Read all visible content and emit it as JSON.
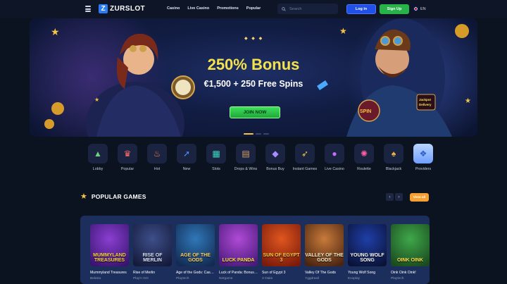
{
  "header": {
    "logo_letter": "Z",
    "logo_text": "ZURSLOT",
    "nav": [
      "Casino",
      "Live Casino",
      "Promotions",
      "Popular"
    ],
    "search_placeholder": "Search",
    "login_label": "Log in",
    "signup_label": "Sign Up",
    "language": "EN"
  },
  "hero": {
    "title": "250% Bonus",
    "subtitle": "€1,500 + 250 Free Spins",
    "cta": "JOIN NOW",
    "sparkle": "◆ ◆ ◆",
    "spin_badge": "SPIN",
    "jackpot_badge": "Jackpot Delivery"
  },
  "categories": [
    {
      "label": "Lobby",
      "icon": "home-icon",
      "glyph": "▲",
      "color": "#6fd37a"
    },
    {
      "label": "Popular",
      "icon": "crown-icon",
      "glyph": "♛",
      "color": "#ff6b6b"
    },
    {
      "label": "Hot",
      "icon": "fire-icon",
      "glyph": "♨",
      "color": "#ff7a3d"
    },
    {
      "label": "New",
      "icon": "rocket-icon",
      "glyph": "➚",
      "color": "#4c8dff"
    },
    {
      "label": "Slots",
      "icon": "slot-machine-icon",
      "glyph": "▦",
      "color": "#3fd6c4"
    },
    {
      "label": "Drops & Wins",
      "icon": "treasure-icon",
      "glyph": "▤",
      "color": "#d9a26b"
    },
    {
      "label": "Bonus Buy",
      "icon": "diamond-icon",
      "glyph": "◆",
      "color": "#a98cff"
    },
    {
      "label": "Instant Games",
      "icon": "rocket-launch-icon",
      "glyph": "➶",
      "color": "#f5c542"
    },
    {
      "label": "Live Casino",
      "icon": "chip-icon",
      "glyph": "●",
      "color": "#c86bff"
    },
    {
      "label": "Roulette",
      "icon": "roulette-icon",
      "glyph": "✺",
      "color": "#ff5fa2"
    },
    {
      "label": "Blackjack",
      "icon": "cards-icon",
      "glyph": "♠",
      "color": "#f0b44c"
    },
    {
      "label": "Providers",
      "icon": "providers-icon",
      "glyph": "❖",
      "color": "#2a61c9"
    }
  ],
  "popular": {
    "title": "POPULAR GAMES",
    "view_all": "View all",
    "prev": "‹",
    "next": "›"
  },
  "games": [
    {
      "title": "Mummyland Treasures",
      "provider": "Belatra",
      "art": "MUMMYLAND TREASURES",
      "bg1": "#8a3fd1",
      "bg2": "#3a1470",
      "fg": "#ffd23f"
    },
    {
      "title": "Rise of Merlin",
      "provider": "Play'n GO",
      "art": "RISE OF MERLIN",
      "bg1": "#3d4f8a",
      "bg2": "#141a3a",
      "fg": "#d9e4ff"
    },
    {
      "title": "Age of the Gods: Cash Collect",
      "provider": "Playtech",
      "art": "AGE OF THE GODS",
      "bg1": "#2f78b8",
      "bg2": "#132a52",
      "fg": "#ffd76b"
    },
    {
      "title": "Luck of Panda: Bonus Combo",
      "provider": "Netgame",
      "art": "LUCK PANDA",
      "bg1": "#b04ad6",
      "bg2": "#4a1a7a",
      "fg": "#ffe34a"
    },
    {
      "title": "Sun of Egypt 3",
      "provider": "3 Oaks",
      "art": "SUN OF EGYPT 3",
      "bg1": "#e0561f",
      "bg2": "#7a1a0a",
      "fg": "#ffd23f"
    },
    {
      "title": "Valley Of The Gods",
      "provider": "Yggdrasil",
      "art": "VALLEY OF THE GODS",
      "bg1": "#c97a3a",
      "bg2": "#4a2410",
      "fg": "#fff1c8"
    },
    {
      "title": "Young Wolf Song",
      "provider": "Evoplay",
      "art": "YOUNG WOLF SONG",
      "bg1": "#1f3fa8",
      "bg2": "#0a1236",
      "fg": "#ffffff"
    },
    {
      "title": "Oink Oink Oink!",
      "provider": "Playtech",
      "art": "OINK OINK",
      "bg1": "#3fa84a",
      "bg2": "#1a4a1f",
      "fg": "#ffe34a"
    }
  ]
}
